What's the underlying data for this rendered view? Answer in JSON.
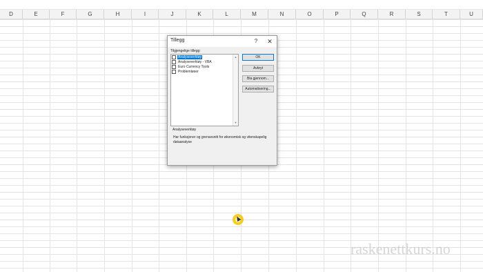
{
  "spreadsheet": {
    "columns": [
      "D",
      "E",
      "F",
      "G",
      "H",
      "I",
      "J",
      "K",
      "L",
      "M",
      "N",
      "O",
      "P",
      "Q",
      "R",
      "S",
      "T",
      "U"
    ]
  },
  "dialog": {
    "title": "Tillegg",
    "help_icon": "?",
    "close_icon": "✕",
    "list_label": "Tilgjengelige tillegg:",
    "items": [
      {
        "label": "Analyseverktøy",
        "checked": false,
        "selected": true
      },
      {
        "label": "Analyseverktøy - VBA",
        "checked": false,
        "selected": false
      },
      {
        "label": "Euro Currency Tools",
        "checked": false,
        "selected": false
      },
      {
        "label": "Problemløser",
        "checked": false,
        "selected": false
      }
    ],
    "buttons": {
      "ok": "OK",
      "cancel": "Avbryt",
      "browse": "Bla gjennom...",
      "automation": "Automatisering..."
    },
    "description_title": "Analyseverktøy",
    "description_text": "Har funksjoner og grensesnitt for økonomisk og vitenskapelig dataanalyse"
  },
  "watermark": "raskenettkurs.no",
  "colors": {
    "accent": "#0078d7",
    "cursor_highlight": "#f5c400"
  }
}
